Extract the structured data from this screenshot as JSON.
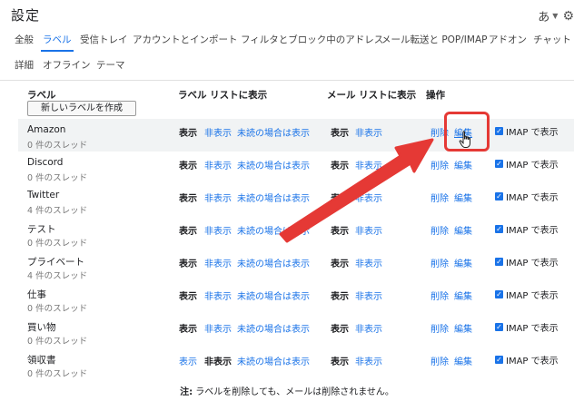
{
  "page": {
    "title": "設定",
    "input_mode": "あ"
  },
  "tabs_row1": [
    "全般",
    "ラベル",
    "受信トレイ",
    "アカウントとインポート",
    "フィルタとブロック中のアドレス",
    "メール転送と POP/IMAP",
    "アドオン",
    "チャット"
  ],
  "tabs_row2": [
    "詳細",
    "オフライン",
    "テーマ"
  ],
  "headers": {
    "label": "ラベル",
    "label_list": "ラベル リストに表示",
    "message_list": "メール リストに表示",
    "actions": "操作"
  },
  "create_button": "新しいラベルを作成",
  "rows": [
    {
      "name": "Amazon",
      "count": "0 件のスレッド",
      "ll1": "表示",
      "ll2": "非表示",
      "ll3": "未読の場合は表示",
      "ml1": "表示",
      "ml2": "非表示",
      "del": "削除",
      "edit": "編集",
      "imap": "IMAP で表示"
    },
    {
      "name": "Discord",
      "count": "0 件のスレッド",
      "ll1": "表示",
      "ll2": "非表示",
      "ll3": "未読の場合は表示",
      "ml1": "表示",
      "ml2": "非表示",
      "del": "削除",
      "edit": "編集",
      "imap": "IMAP で表示"
    },
    {
      "name": "Twitter",
      "count": "4 件のスレッド",
      "ll1": "表示",
      "ll2": "非表示",
      "ll3": "未読の場合は表示",
      "ml1": "表示",
      "ml2": "非表示",
      "del": "削除",
      "edit": "編集",
      "imap": "IMAP で表示"
    },
    {
      "name": "テスト",
      "count": "0 件のスレッド",
      "ll1": "表示",
      "ll2": "非表示",
      "ll3": "未読の場合は表示",
      "ml1": "表示",
      "ml2": "非表示",
      "del": "削除",
      "edit": "編集",
      "imap": "IMAP で表示"
    },
    {
      "name": "プライベート",
      "count": "4 件のスレッド",
      "ll1": "表示",
      "ll2": "非表示",
      "ll3": "未読の場合は表示",
      "ml1": "表示",
      "ml2": "非表示",
      "del": "削除",
      "edit": "編集",
      "imap": "IMAP で表示"
    },
    {
      "name": "仕事",
      "count": "0 件のスレッド",
      "ll1": "表示",
      "ll2": "非表示",
      "ll3": "未読の場合は表示",
      "ml1": "表示",
      "ml2": "非表示",
      "del": "削除",
      "edit": "編集",
      "imap": "IMAP で表示"
    },
    {
      "name": "買い物",
      "count": "0 件のスレッド",
      "ll1": "表示",
      "ll2": "非表示",
      "ll3": "未読の場合は表示",
      "ml1": "表示",
      "ml2": "非表示",
      "del": "削除",
      "edit": "編集",
      "imap": "IMAP で表示"
    },
    {
      "name": "領収書",
      "count": "0 件のスレッド",
      "ll1": "表示",
      "ll2": "非表示",
      "ll3": "未読の場合は表示",
      "ml1": "表示",
      "ml2": "非表示",
      "del": "削除",
      "edit": "編集",
      "imap": "IMAP で表示"
    }
  ],
  "footer": {
    "prefix": "注:",
    "text": " ラベルを削除しても、メールは削除されません。"
  },
  "colors": {
    "accent": "#1a73e8",
    "annotation": "#e53935",
    "row_highlight": "#f1f3f4"
  }
}
